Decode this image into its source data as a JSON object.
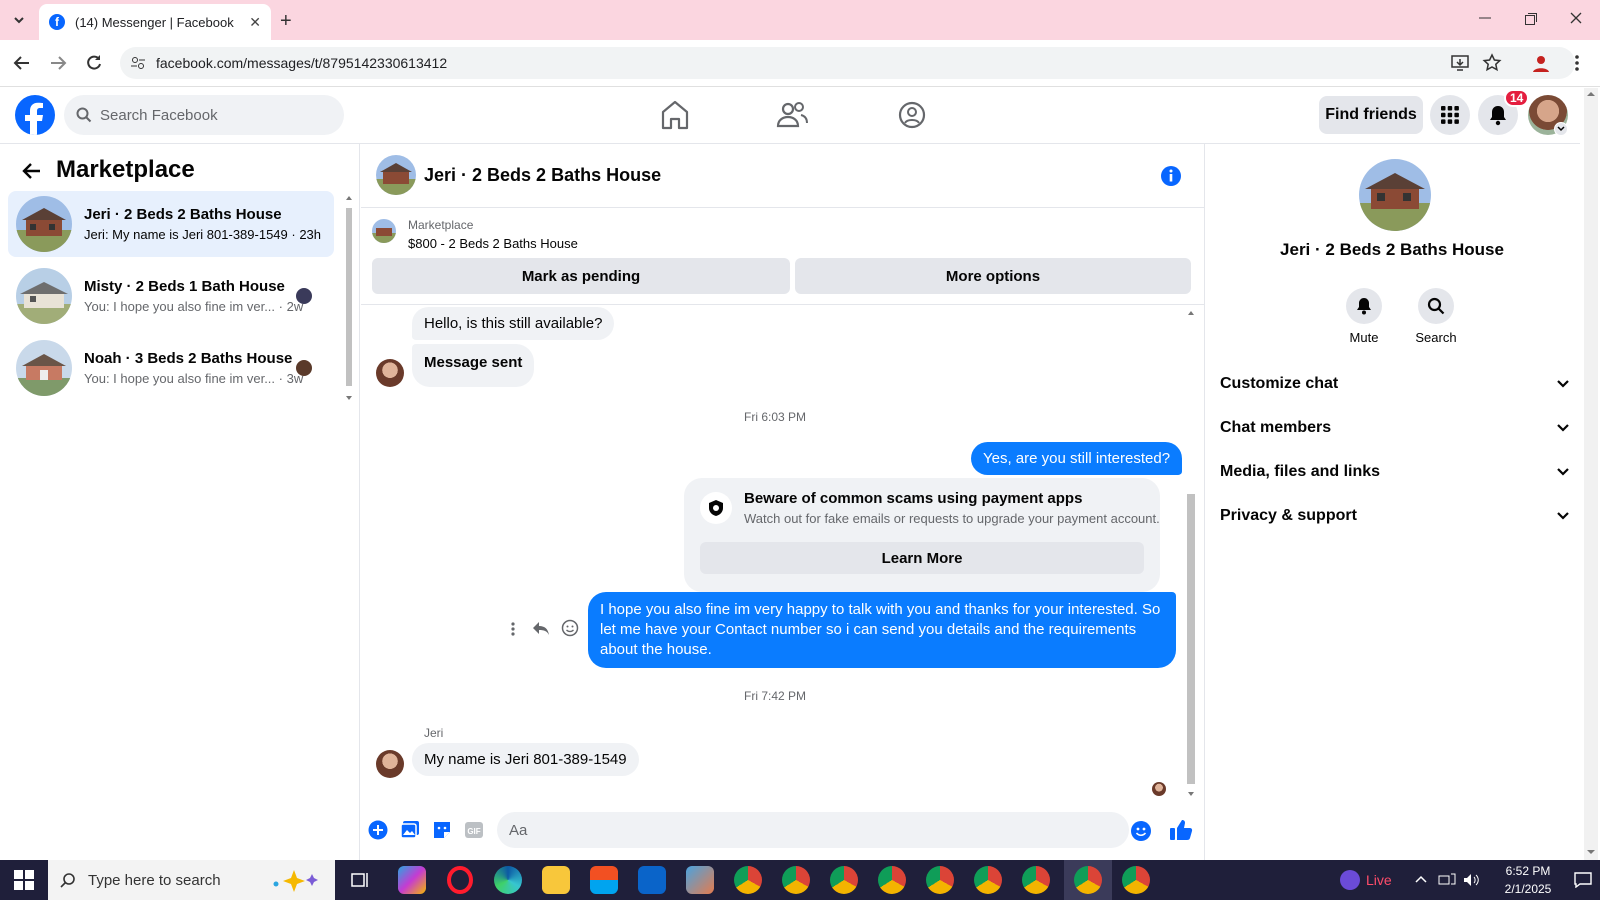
{
  "browser": {
    "tab_title": "(14) Messenger | Facebook",
    "url": "facebook.com/messages/t/8795142330613412"
  },
  "fb": {
    "search_placeholder": "Search Facebook",
    "find_friends": "Find friends",
    "notification_count": "14"
  },
  "sidebar": {
    "title": "Marketplace",
    "conversations": [
      {
        "name": "Jeri · 2 Beds 2 Baths House",
        "preview": "Jeri: My name is Jeri 801-389-1549",
        "time": "23h"
      },
      {
        "name": "Misty · 2 Beds 1 Bath House",
        "preview": "You: I hope you also fine im ver...",
        "time": "2w"
      },
      {
        "name": "Noah · 3 Beds 2 Baths House",
        "preview": "You: I hope you also fine im ver...",
        "time": "3w"
      }
    ]
  },
  "chat": {
    "title": "Jeri · 2 Beds 2 Baths House",
    "listing_source": "Marketplace",
    "listing_price": "$800 - 2 Beds 2 Baths House",
    "mark_pending": "Mark as pending",
    "more_options": "More options",
    "messages": {
      "m1": "Hello, is this still available?",
      "m2": "Message sent",
      "ts1": "Fri 6:03 PM",
      "m3": "Yes, are you still interested?",
      "scam_title": "Beware of common scams using payment apps",
      "scam_body": "Watch out for fake emails or requests to upgrade your payment account.",
      "learn_more": "Learn More",
      "m4": "I hope you also fine im very happy to talk with you and thanks for your interested. So let me have your Contact number so i can send you details and the requirements about the house.",
      "ts2": "Fri 7:42 PM",
      "sender": "Jeri",
      "m5": "My name is Jeri 801-389-1549"
    },
    "composer_placeholder": "Aa"
  },
  "info_panel": {
    "title": "Jeri · 2 Beds 2 Baths House",
    "mute": "Mute",
    "search": "Search",
    "sections": [
      "Customize chat",
      "Chat members",
      "Media, files and links",
      "Privacy & support"
    ]
  },
  "taskbar": {
    "search_placeholder": "Type here to search",
    "live": "Live",
    "time": "6:52 PM",
    "date": "2/1/2025"
  },
  "colors": {
    "accent": "#0866ff",
    "bubble_out": "#0a7cff",
    "tab_bar": "#fbd6e0"
  }
}
